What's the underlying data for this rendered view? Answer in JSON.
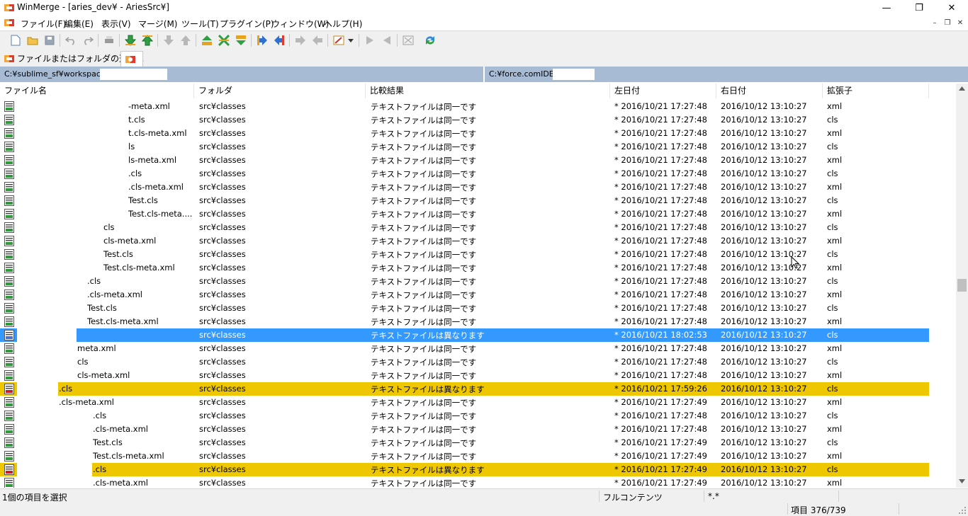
{
  "window": {
    "title": "WinMerge - [aries_dev¥ - AriesSrc¥]",
    "controls": [
      "minimize",
      "restore",
      "close"
    ]
  },
  "menu": [
    "ファイル(F)",
    "編集(E)",
    "表示(V)",
    "マージ(M)",
    "ツール(T)",
    "プラグイン(P)",
    "ウィンドウ(W)",
    "ヘルプ(H)"
  ],
  "toolbar": {
    "buttons": [
      "new-icon",
      "open-icon",
      "save-icon",
      "undo-icon",
      "redo-icon",
      "print-icon",
      "next-diff-icon",
      "prev-diff-icon",
      "first-diff-icon",
      "last-diff-icon",
      "current-diff-icon",
      "copy-right-icon",
      "copy-left-icon",
      "all-right-icon",
      "all-left-icon",
      "copy-to-right-icon",
      "copy-to-left-icon",
      "options-icon",
      "dropdown-icon",
      "move-right-icon",
      "move-left-icon",
      "compare-icon",
      "refresh-icon"
    ]
  },
  "tabs": [
    {
      "label": "ファイルまたはフォルダの選択...",
      "active": false
    },
    {
      "label": "",
      "active": true
    }
  ],
  "paths": {
    "left": "C:¥sublime_sf¥workspace",
    "right": "C:¥force.comIDE"
  },
  "columns": [
    "ファイル名",
    "フォルダ",
    "比較結果",
    "左日付",
    "右日付",
    "拡張子"
  ],
  "rows": [
    {
      "name": "-meta.xml",
      "folder": "src¥classes",
      "result": "テキストファイルは同一です",
      "left_date": "* 2016/10/21 17:27:48",
      "right_date": "2016/10/12 13:10:27",
      "ext": "xml",
      "status": "same",
      "mask": 180
    },
    {
      "name": "t.cls",
      "folder": "src¥classes",
      "result": "テキストファイルは同一です",
      "left_date": "* 2016/10/21 17:27:48",
      "right_date": "2016/10/12 13:10:27",
      "ext": "cls",
      "status": "same",
      "mask": 180
    },
    {
      "name": "t.cls-meta.xml",
      "folder": "src¥classes",
      "result": "テキストファイルは同一です",
      "left_date": "* 2016/10/21 17:27:48",
      "right_date": "2016/10/12 13:10:27",
      "ext": "xml",
      "status": "same",
      "mask": 180
    },
    {
      "name": "ls",
      "folder": "src¥classes",
      "result": "テキストファイルは同一です",
      "left_date": "* 2016/10/21 17:27:48",
      "right_date": "2016/10/12 13:10:27",
      "ext": "cls",
      "status": "same",
      "mask": 180
    },
    {
      "name": "ls-meta.xml",
      "folder": "src¥classes",
      "result": "テキストファイルは同一です",
      "left_date": "* 2016/10/21 17:27:48",
      "right_date": "2016/10/12 13:10:27",
      "ext": "xml",
      "status": "same",
      "mask": 180
    },
    {
      "name": ".cls",
      "folder": "src¥classes",
      "result": "テキストファイルは同一です",
      "left_date": "* 2016/10/21 17:27:48",
      "right_date": "2016/10/12 13:10:27",
      "ext": "cls",
      "status": "same",
      "mask": 180
    },
    {
      "name": ".cls-meta.xml",
      "folder": "src¥classes",
      "result": "テキストファイルは同一です",
      "left_date": "* 2016/10/21 17:27:48",
      "right_date": "2016/10/12 13:10:27",
      "ext": "xml",
      "status": "same",
      "mask": 180
    },
    {
      "name": "Test.cls",
      "folder": "src¥classes",
      "result": "テキストファイルは同一です",
      "left_date": "* 2016/10/21 17:27:48",
      "right_date": "2016/10/12 13:10:27",
      "ext": "cls",
      "status": "same",
      "mask": 180
    },
    {
      "name": "Test.cls-meta....",
      "folder": "src¥classes",
      "result": "テキストファイルは同一です",
      "left_date": "* 2016/10/21 17:27:48",
      "right_date": "2016/10/12 13:10:27",
      "ext": "xml",
      "status": "same",
      "mask": 180
    },
    {
      "name": "cls",
      "folder": "src¥classes",
      "result": "テキストファイルは同一です",
      "left_date": "* 2016/10/21 17:27:48",
      "right_date": "2016/10/12 13:10:27",
      "ext": "cls",
      "status": "same",
      "mask": 145
    },
    {
      "name": "cls-meta.xml",
      "folder": "src¥classes",
      "result": "テキストファイルは同一です",
      "left_date": "* 2016/10/21 17:27:48",
      "right_date": "2016/10/12 13:10:27",
      "ext": "xml",
      "status": "same",
      "mask": 145
    },
    {
      "name": "Test.cls",
      "folder": "src¥classes",
      "result": "テキストファイルは同一です",
      "left_date": "* 2016/10/21 17:27:48",
      "right_date": "2016/10/12 13:10:27",
      "ext": "cls",
      "status": "same",
      "mask": 145
    },
    {
      "name": "Test.cls-meta.xml",
      "folder": "src¥classes",
      "result": "テキストファイルは同一です",
      "left_date": "* 2016/10/21 17:27:48",
      "right_date": "2016/10/12 13:10:27",
      "ext": "xml",
      "status": "same",
      "mask": 145
    },
    {
      "name": ".cls",
      "folder": "src¥classes",
      "result": "テキストファイルは同一です",
      "left_date": "* 2016/10/21 17:27:48",
      "right_date": "2016/10/12 13:10:27",
      "ext": "cls",
      "status": "same",
      "mask": 122
    },
    {
      "name": ".cls-meta.xml",
      "folder": "src¥classes",
      "result": "テキストファイルは同一です",
      "left_date": "* 2016/10/21 17:27:48",
      "right_date": "2016/10/12 13:10:27",
      "ext": "xml",
      "status": "same",
      "mask": 122
    },
    {
      "name": "Test.cls",
      "folder": "src¥classes",
      "result": "テキストファイルは同一です",
      "left_date": "* 2016/10/21 17:27:48",
      "right_date": "2016/10/12 13:10:27",
      "ext": "cls",
      "status": "same",
      "mask": 122
    },
    {
      "name": "Test.cls-meta.xml",
      "folder": "src¥classes",
      "result": "テキストファイルは同一です",
      "left_date": "* 2016/10/21 17:27:48",
      "right_date": "2016/10/12 13:10:27",
      "ext": "xml",
      "status": "same",
      "mask": 122
    },
    {
      "name": "",
      "folder": "src¥classes",
      "result": "テキストファイルは異なります",
      "left_date": "* 2016/10/21 18:02:53",
      "right_date": "2016/10/12 13:10:27",
      "ext": "cls",
      "status": "selected",
      "mask": 108
    },
    {
      "name": "meta.xml",
      "folder": "src¥classes",
      "result": "テキストファイルは同一です",
      "left_date": "* 2016/10/21 17:27:48",
      "right_date": "2016/10/12 13:10:27",
      "ext": "xml",
      "status": "same",
      "mask": 108
    },
    {
      "name": "cls",
      "folder": "src¥classes",
      "result": "テキストファイルは同一です",
      "left_date": "* 2016/10/21 17:27:48",
      "right_date": "2016/10/12 13:10:27",
      "ext": "cls",
      "status": "same",
      "mask": 108
    },
    {
      "name": "cls-meta.xml",
      "folder": "src¥classes",
      "result": "テキストファイルは同一です",
      "left_date": "* 2016/10/21 17:27:48",
      "right_date": "2016/10/12 13:10:27",
      "ext": "xml",
      "status": "same",
      "mask": 108
    },
    {
      "name": ".cls",
      "folder": "src¥classes",
      "result": "テキストファイルは異なります",
      "left_date": "* 2016/10/21 17:59:26",
      "right_date": "2016/10/12 13:10:27",
      "ext": "cls",
      "status": "diff",
      "mask": 82
    },
    {
      "name": ".cls-meta.xml",
      "folder": "src¥classes",
      "result": "テキストファイルは同一です",
      "left_date": "* 2016/10/21 17:27:49",
      "right_date": "2016/10/12 13:10:27",
      "ext": "xml",
      "status": "same",
      "mask": 82
    },
    {
      "name": ".cls",
      "folder": "src¥classes",
      "result": "テキストファイルは同一です",
      "left_date": "* 2016/10/21 17:27:48",
      "right_date": "2016/10/12 13:10:27",
      "ext": "cls",
      "status": "same",
      "mask": 130
    },
    {
      "name": ".cls-meta.xml",
      "folder": "src¥classes",
      "result": "テキストファイルは同一です",
      "left_date": "* 2016/10/21 17:27:48",
      "right_date": "2016/10/12 13:10:27",
      "ext": "xml",
      "status": "same",
      "mask": 130
    },
    {
      "name": "Test.cls",
      "folder": "src¥classes",
      "result": "テキストファイルは同一です",
      "left_date": "* 2016/10/21 17:27:49",
      "right_date": "2016/10/12 13:10:27",
      "ext": "cls",
      "status": "same",
      "mask": 130
    },
    {
      "name": "Test.cls-meta.xml",
      "folder": "src¥classes",
      "result": "テキストファイルは同一です",
      "left_date": "* 2016/10/21 17:27:49",
      "right_date": "2016/10/12 13:10:27",
      "ext": "xml",
      "status": "same",
      "mask": 130
    },
    {
      "name": ".cls",
      "folder": "src¥classes",
      "result": "テキストファイルは異なります",
      "left_date": "* 2016/10/21 17:27:49",
      "right_date": "2016/10/12 13:10:27",
      "ext": "cls",
      "status": "diff",
      "mask": 130
    },
    {
      "name": ".cls-meta.xml",
      "folder": "src¥classes",
      "result": "テキストファイルは同一です",
      "left_date": "* 2016/10/21 17:27:49",
      "right_date": "2016/10/12 13:10:27",
      "ext": "xml",
      "status": "same",
      "mask": 130
    }
  ],
  "status": {
    "selection": "1個の項目を選択",
    "compare_method": "フルコンテンツ",
    "filter": "*.*",
    "items": "項目 376/739"
  },
  "colors": {
    "diff_row": "#efc700",
    "selected_row": "#3399ff",
    "path_bar": "#a7bbd5",
    "same_icon": "#2e9a3a",
    "diff_icon": "#c8202a"
  }
}
